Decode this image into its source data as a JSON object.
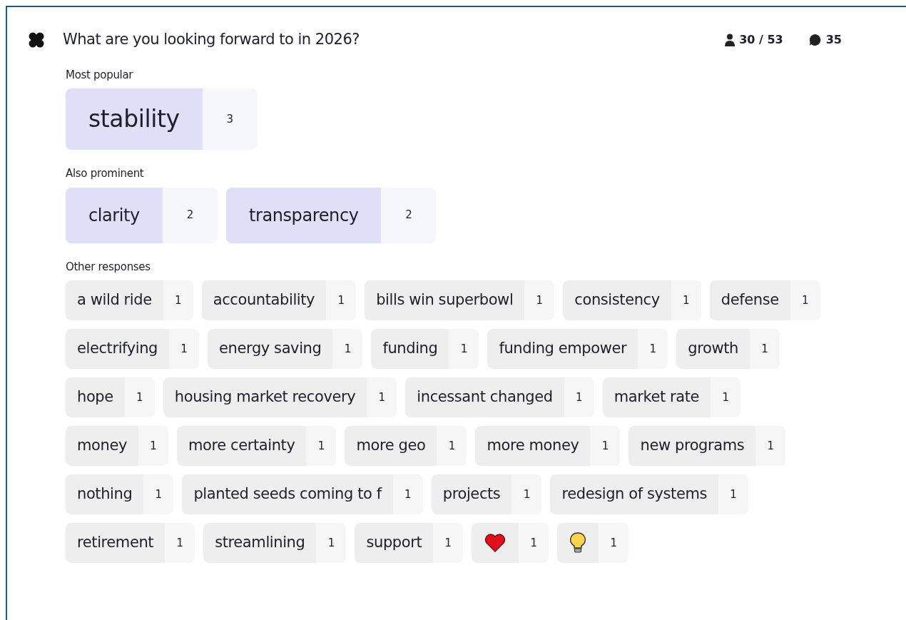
{
  "question": {
    "title": "What are you looking forward to in 2026?",
    "participants": "30 / 53",
    "responses": "35"
  },
  "sections": [
    {
      "title": "Most popular",
      "kind": "top",
      "items": [
        {
          "kind": "text",
          "label": "stability",
          "count": "3"
        }
      ]
    },
    {
      "title": "Also prominent",
      "kind": "prominent",
      "items": [
        {
          "kind": "text",
          "label": "clarity",
          "count": "2"
        },
        {
          "kind": "text",
          "label": "transparency",
          "count": "2"
        }
      ]
    },
    {
      "title": "Other responses",
      "kind": "other",
      "items": [
        {
          "kind": "text",
          "label": "a wild ride",
          "count": "1"
        },
        {
          "kind": "text",
          "label": "accountability",
          "count": "1"
        },
        {
          "kind": "text",
          "label": "bills win superbowl",
          "count": "1"
        },
        {
          "kind": "text",
          "label": "consistency",
          "count": "1"
        },
        {
          "kind": "text",
          "label": "defense",
          "count": "1"
        },
        {
          "kind": "text",
          "label": "electrifying",
          "count": "1"
        },
        {
          "kind": "text",
          "label": "energy saving",
          "count": "1"
        },
        {
          "kind": "text",
          "label": "funding",
          "count": "1"
        },
        {
          "kind": "text",
          "label": "funding empower",
          "count": "1"
        },
        {
          "kind": "text",
          "label": "growth",
          "count": "1"
        },
        {
          "kind": "text",
          "label": "hope",
          "count": "1"
        },
        {
          "kind": "text",
          "label": "housing market recovery",
          "count": "1"
        },
        {
          "kind": "text",
          "label": "incessant changed",
          "count": "1"
        },
        {
          "kind": "text",
          "label": "market rate",
          "count": "1"
        },
        {
          "kind": "text",
          "label": "money",
          "count": "1"
        },
        {
          "kind": "text",
          "label": "more certainty",
          "count": "1"
        },
        {
          "kind": "text",
          "label": "more geo",
          "count": "1"
        },
        {
          "kind": "text",
          "label": "more money",
          "count": "1"
        },
        {
          "kind": "text",
          "label": "new programs",
          "count": "1"
        },
        {
          "kind": "text",
          "label": "nothing",
          "count": "1"
        },
        {
          "kind": "text",
          "label": "planted seeds coming to f",
          "count": "1"
        },
        {
          "kind": "text",
          "label": "projects",
          "count": "1"
        },
        {
          "kind": "text",
          "label": "redesign of systems",
          "count": "1"
        },
        {
          "kind": "text",
          "label": "retirement",
          "count": "1"
        },
        {
          "kind": "text",
          "label": "streamlining",
          "count": "1"
        },
        {
          "kind": "text",
          "label": "support",
          "count": "1"
        },
        {
          "kind": "heart",
          "count": "1"
        },
        {
          "kind": "bulb",
          "count": "1"
        }
      ]
    }
  ]
}
